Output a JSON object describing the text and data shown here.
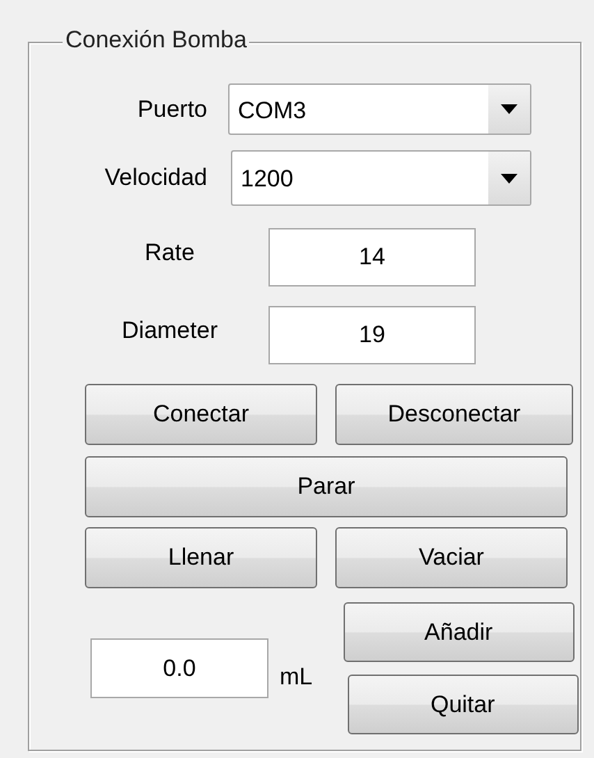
{
  "panel": {
    "title": "Conexión Bomba"
  },
  "selects": [
    {
      "label": "Puerto",
      "value": "COM3"
    },
    {
      "label": "Velocidad",
      "value": "1200"
    }
  ],
  "fields": [
    {
      "label": "Rate",
      "value": "14"
    },
    {
      "label": "Diameter",
      "value": "19"
    }
  ],
  "buttons": {
    "connect": "Conectar",
    "disconnect": "Desconectar",
    "stop": "Parar",
    "fill": "Llenar",
    "empty": "Vaciar",
    "add": "Añadir",
    "remove": "Quitar"
  },
  "volume": {
    "value": "0.0",
    "unit": "mL"
  }
}
